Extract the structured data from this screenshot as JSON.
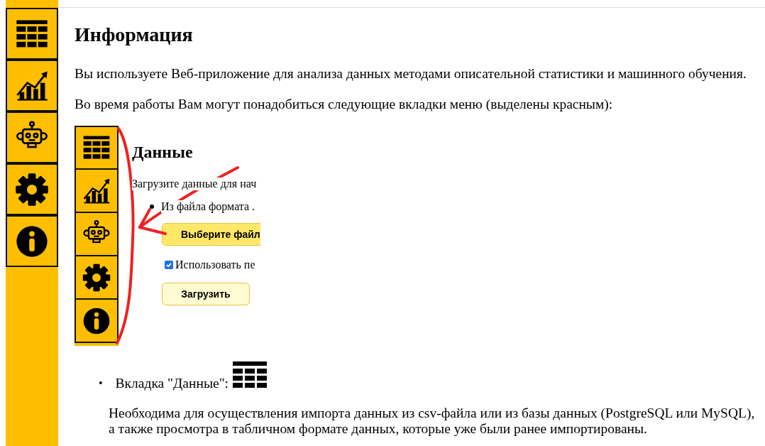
{
  "page": {
    "title": "Информация",
    "paragraphs": [
      "Вы используете Веб-приложение для анализа данных методами описательной статистики и машинного обучения.",
      "Во время работы Вам могут понадобиться следующие вкладки меню (выделены красным):"
    ]
  },
  "embedded_screenshot": {
    "title": "Данные",
    "intro": "Загрузите данные для нач",
    "bullet": "Из файла формата .",
    "file_button": "Выберите файл",
    "checkbox": {
      "label": "Использовать пе",
      "checked": true
    },
    "load_button": "Загрузить"
  },
  "tab_descriptions": [
    {
      "marker": "•",
      "label": "Вкладка \"Данные\":",
      "text": "Необходима для осуществления импорта данных из csv-файла или из базы данных (PostgreSQL или MySQL), а также просмотра в табличном формате данных, которые уже были ранее импортированы."
    }
  ]
}
